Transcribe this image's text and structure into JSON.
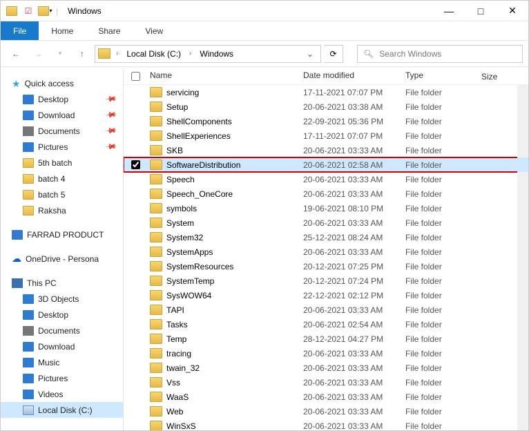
{
  "title": "Windows",
  "tabs": {
    "file": "File",
    "home": "Home",
    "share": "Share",
    "view": "View"
  },
  "breadcrumb": {
    "drive": "Local Disk (C:)",
    "folder": "Windows"
  },
  "search": {
    "placeholder": "Search Windows"
  },
  "columns": {
    "name": "Name",
    "date": "Date modified",
    "type": "Type",
    "size": "Size"
  },
  "sidebar": {
    "quick_access": "Quick access",
    "items_qa": [
      {
        "label": "Desktop",
        "pinned": true,
        "icon": "blue"
      },
      {
        "label": "Download",
        "pinned": true,
        "icon": "blue"
      },
      {
        "label": "Documents",
        "pinned": true,
        "icon": "gray"
      },
      {
        "label": "Pictures",
        "pinned": true,
        "icon": "blue"
      },
      {
        "label": "5th batch",
        "pinned": false,
        "icon": "folder"
      },
      {
        "label": "batch 4",
        "pinned": false,
        "icon": "folder"
      },
      {
        "label": "batch 5",
        "pinned": false,
        "icon": "folder"
      },
      {
        "label": "Raksha",
        "pinned": false,
        "icon": "folder"
      }
    ],
    "farrad": "FARRAD PRODUCT",
    "onedrive": "OneDrive - Persona",
    "this_pc": "This PC",
    "items_pc": [
      {
        "label": "3D Objects",
        "icon": "blue"
      },
      {
        "label": "Desktop",
        "icon": "blue"
      },
      {
        "label": "Documents",
        "icon": "gray"
      },
      {
        "label": "Download",
        "icon": "blue"
      },
      {
        "label": "Music",
        "icon": "blue"
      },
      {
        "label": "Pictures",
        "icon": "blue"
      },
      {
        "label": "Videos",
        "icon": "blue"
      },
      {
        "label": "Local Disk (C:)",
        "icon": "disk",
        "selected": true
      }
    ]
  },
  "files": [
    {
      "name": "servicing",
      "date": "17-11-2021 07:07 PM",
      "type": "File folder"
    },
    {
      "name": "Setup",
      "date": "20-06-2021 03:38 AM",
      "type": "File folder"
    },
    {
      "name": "ShellComponents",
      "date": "22-09-2021 05:36 PM",
      "type": "File folder"
    },
    {
      "name": "ShellExperiences",
      "date": "17-11-2021 07:07 PM",
      "type": "File folder"
    },
    {
      "name": "SKB",
      "date": "20-06-2021 03:33 AM",
      "type": "File folder"
    },
    {
      "name": "SoftwareDistribution",
      "date": "20-06-2021 02:58 AM",
      "type": "File folder",
      "selected": true
    },
    {
      "name": "Speech",
      "date": "20-06-2021 03:33 AM",
      "type": "File folder"
    },
    {
      "name": "Speech_OneCore",
      "date": "20-06-2021 03:33 AM",
      "type": "File folder"
    },
    {
      "name": "symbols",
      "date": "19-06-2021 08:10 PM",
      "type": "File folder"
    },
    {
      "name": "System",
      "date": "20-06-2021 03:33 AM",
      "type": "File folder"
    },
    {
      "name": "System32",
      "date": "25-12-2021 08:24 AM",
      "type": "File folder"
    },
    {
      "name": "SystemApps",
      "date": "20-06-2021 03:33 AM",
      "type": "File folder"
    },
    {
      "name": "SystemResources",
      "date": "20-12-2021 07:25 PM",
      "type": "File folder"
    },
    {
      "name": "SystemTemp",
      "date": "20-12-2021 07:24 PM",
      "type": "File folder"
    },
    {
      "name": "SysWOW64",
      "date": "22-12-2021 02:12 PM",
      "type": "File folder"
    },
    {
      "name": "TAPI",
      "date": "20-06-2021 03:33 AM",
      "type": "File folder"
    },
    {
      "name": "Tasks",
      "date": "20-06-2021 02:54 AM",
      "type": "File folder"
    },
    {
      "name": "Temp",
      "date": "28-12-2021 04:27 PM",
      "type": "File folder"
    },
    {
      "name": "tracing",
      "date": "20-06-2021 03:33 AM",
      "type": "File folder"
    },
    {
      "name": "twain_32",
      "date": "20-06-2021 03:33 AM",
      "type": "File folder"
    },
    {
      "name": "Vss",
      "date": "20-06-2021 03:33 AM",
      "type": "File folder"
    },
    {
      "name": "WaaS",
      "date": "20-06-2021 03:33 AM",
      "type": "File folder"
    },
    {
      "name": "Web",
      "date": "20-06-2021 03:33 AM",
      "type": "File folder"
    },
    {
      "name": "WinSxS",
      "date": "20-06-2021 03:33 AM",
      "type": "File folder"
    }
  ]
}
